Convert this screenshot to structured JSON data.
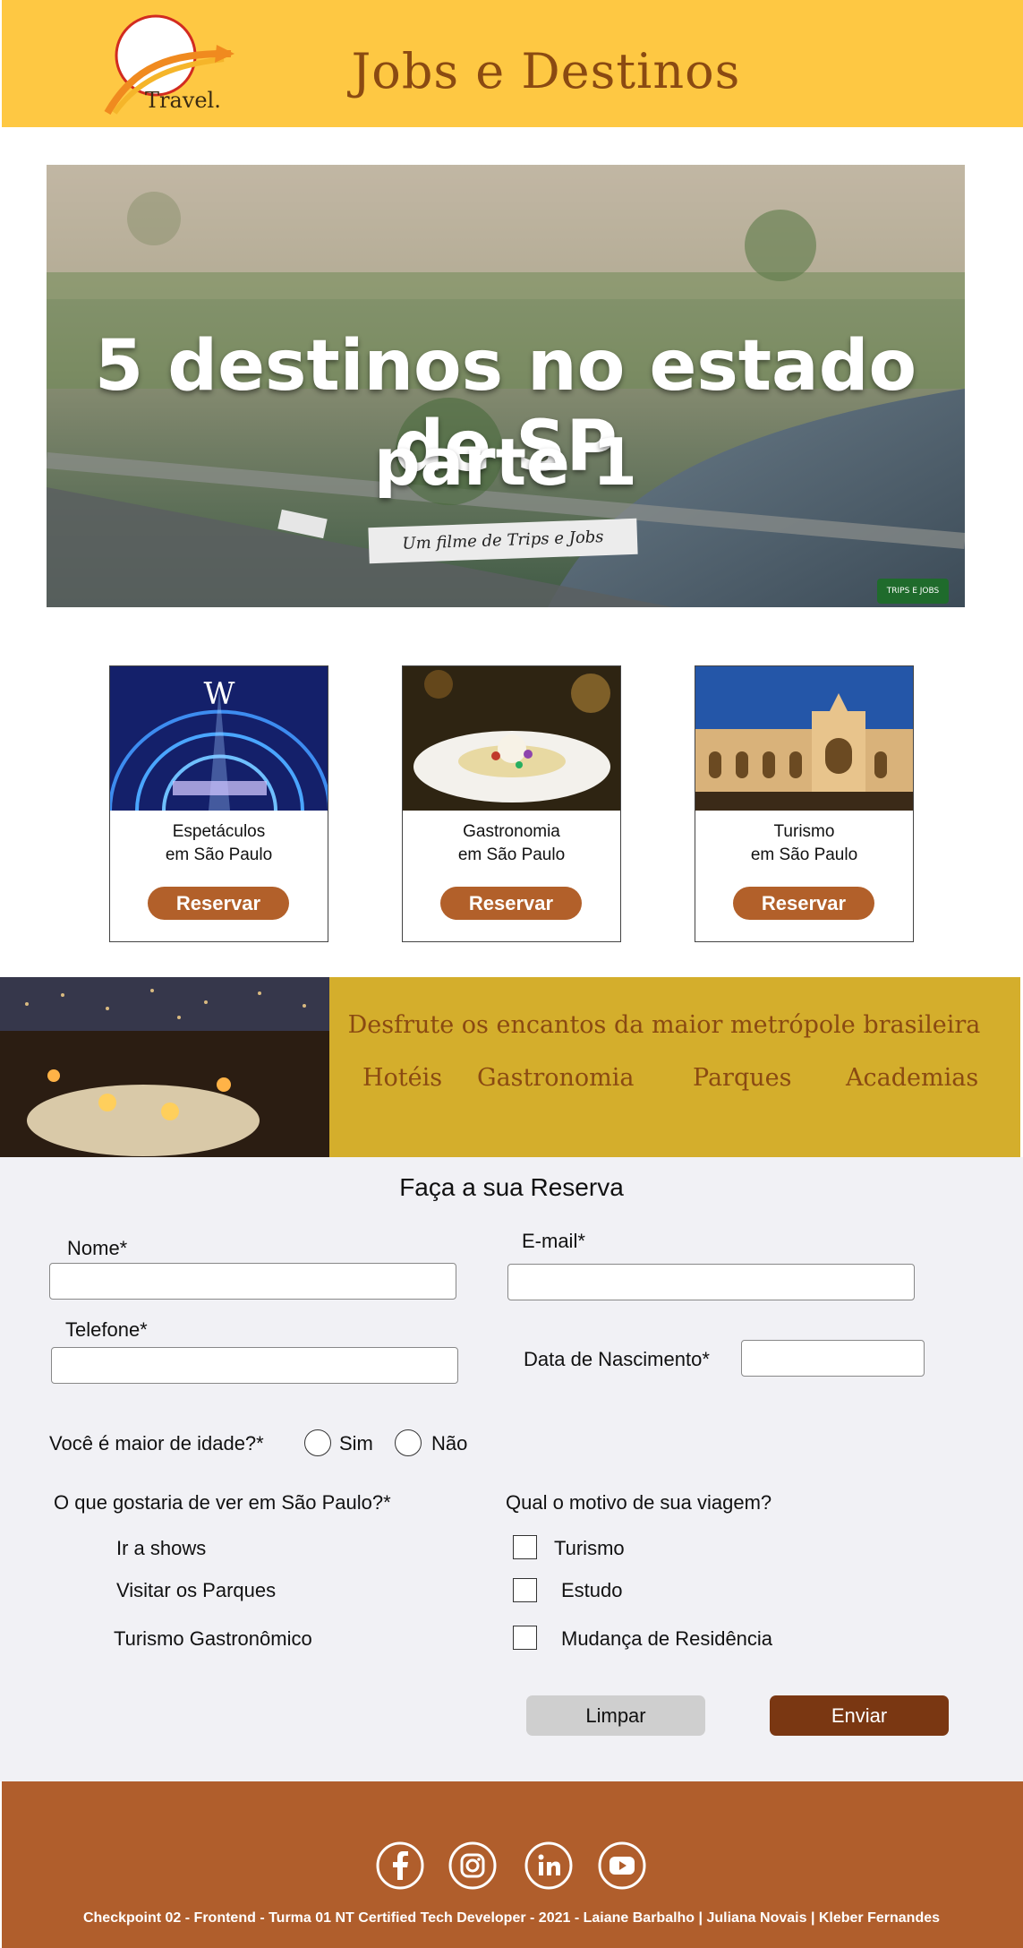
{
  "header": {
    "logo_text": "Travel.",
    "title": "Jobs e Destinos"
  },
  "hero": {
    "line1": "5 destinos no estado de SP",
    "line2": "parte 1",
    "strip": "Um filme de Trips e Jobs",
    "watermark": "TRIPS E JOBS"
  },
  "cards": [
    {
      "label_line1": "Espetáculos",
      "label_line2": "em São Paulo",
      "button": "Reservar"
    },
    {
      "label_line1": "Gastronomia",
      "label_line2": "em São Paulo",
      "button": "Reservar"
    },
    {
      "label_line1": "Turismo",
      "label_line2": "em São Paulo",
      "button": "Reservar"
    }
  ],
  "banner": {
    "heading": "Desfrute os encantos da maior metrópole brasileira",
    "links": [
      "Hotéis",
      "Gastronomia",
      "Parques",
      "Academias"
    ]
  },
  "form": {
    "title": "Faça a sua Reserva",
    "name_label": "Nome*",
    "email_label": "E-mail*",
    "phone_label": "Telefone*",
    "birth_label": "Data de Nascimento*",
    "adult_question": "Você é maior de idade?*",
    "adult_yes": "Sim",
    "adult_no": "Não",
    "interests_question": "O que gostaria de ver em São Paulo?*",
    "interests": [
      "Ir a shows",
      "Visitar os Parques",
      "Turismo Gastronômico"
    ],
    "reason_question": "Qual o motivo de sua viagem?",
    "reasons": [
      "Turismo",
      "Estudo",
      "Mudança de Residência"
    ],
    "clear_button": "Limpar",
    "send_button": "Enviar"
  },
  "footer": {
    "social_icons": [
      "facebook-icon",
      "instagram-icon",
      "linkedin-icon",
      "youtube-icon"
    ],
    "credits": "Checkpoint 02 - Frontend - Turma 01 NT Certified Tech Developer - 2021 - Laiane Barbalho  |  Juliana Novais  |  Kleber Fernandes"
  },
  "colors": {
    "header_bg": "#fec843",
    "title_brown": "#8a4a12",
    "button_brown": "#b2602a",
    "banner_bg": "#d4ae2c",
    "send_bg": "#7a3712",
    "footer_bg": "#b05e2c",
    "form_bg": "#f1f1f5"
  }
}
